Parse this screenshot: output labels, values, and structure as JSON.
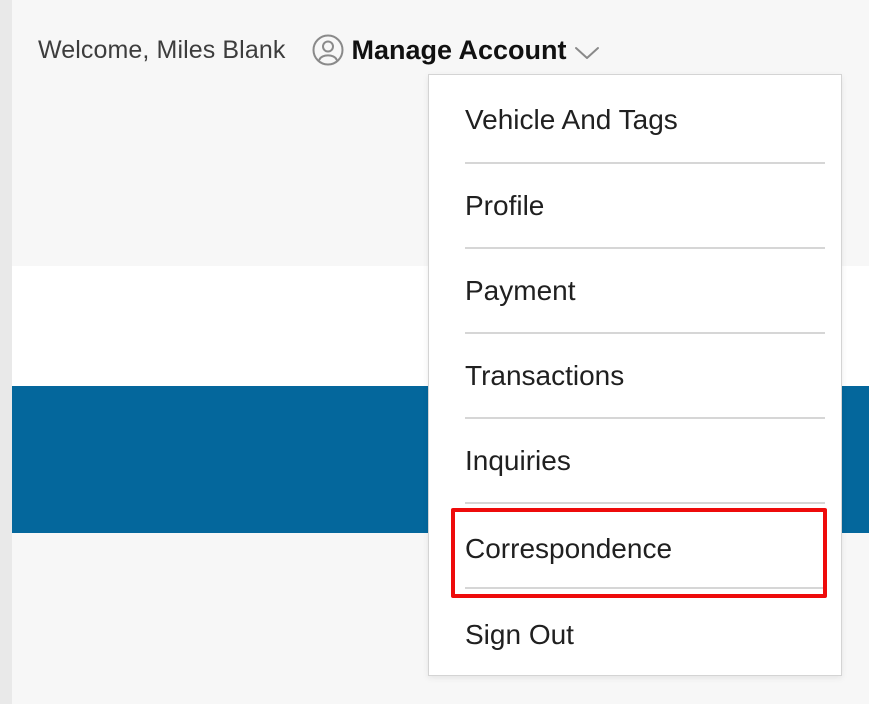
{
  "header": {
    "welcome_text": "Welcome, Miles Blank",
    "account_label": "Manage Account",
    "user_icon": "user-circle-icon",
    "chevron_icon": "chevron-down-icon"
  },
  "menu": {
    "items": [
      {
        "label": "Vehicle And Tags"
      },
      {
        "label": "Profile"
      },
      {
        "label": "Payment"
      },
      {
        "label": "Transactions"
      },
      {
        "label": "Inquiries"
      },
      {
        "label": "Correspondence",
        "highlighted": true
      },
      {
        "label": "Sign Out"
      }
    ]
  },
  "colors": {
    "page_background": "#f7f7f7",
    "band_blue": "#04679c",
    "highlight_border": "#ee0b0b"
  }
}
